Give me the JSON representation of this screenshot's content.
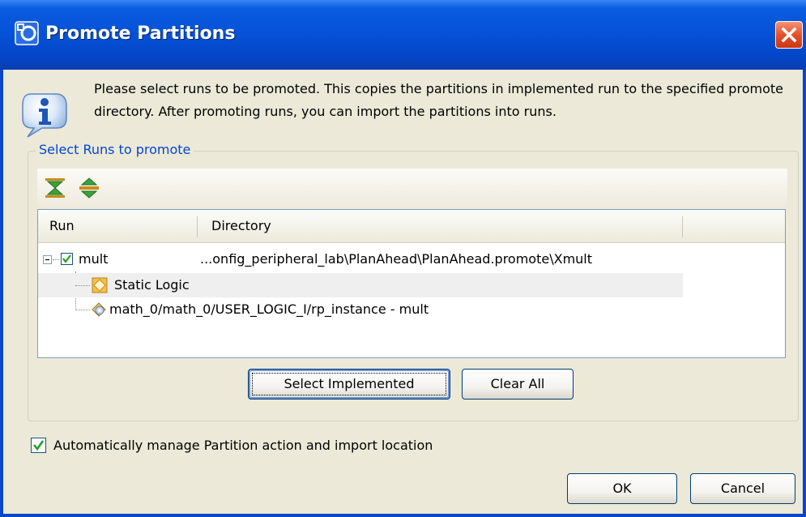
{
  "window": {
    "title": "Promote Partitions"
  },
  "message": {
    "text": "Please select runs to be promoted. This copies the partitions in implemented run to the specified promote directory. After promoting runs, you can import the partitions into runs."
  },
  "group": {
    "legend": "Select Runs to promote"
  },
  "toolbar": {
    "icons": [
      "expand-all-icon",
      "collapse-all-icon"
    ]
  },
  "table": {
    "columns": [
      "Run",
      "Directory"
    ],
    "rows": [
      {
        "run": "mult",
        "directory": "...onfig_peripheral_lab\\PlanAhead\\PlanAhead.promote\\Xmult",
        "checked": true,
        "expanded": true
      },
      {
        "run": "Static Logic",
        "directory": ""
      },
      {
        "run": "math_0/math_0/USER_LOGIC_I/rp_instance - mult",
        "directory": ""
      }
    ]
  },
  "buttons": {
    "select_implemented": "Select Implemented",
    "clear_all": "Clear All",
    "ok": "OK",
    "cancel": "Cancel"
  },
  "options": {
    "auto_manage_label": "Automatically manage Partition action and import location",
    "auto_manage_checked": true
  },
  "colors": {
    "titlebar": "#0653d8",
    "dialog_bg": "#ece9d8",
    "legend_text": "#0046d5",
    "close_button": "#e4512c",
    "checkmark": "#21a121"
  }
}
